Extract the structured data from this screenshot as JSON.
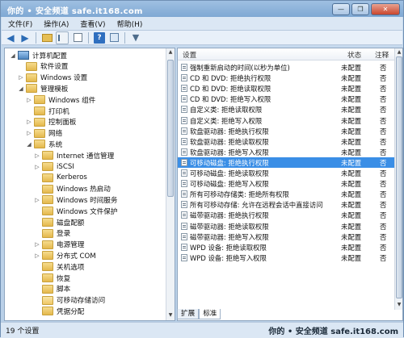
{
  "window": {
    "title": "你的 • 安全频道  safe.it168.com",
    "buttons": [
      "—",
      "❐",
      "✕"
    ]
  },
  "menubar": [
    "文件(F)",
    "操作(A)",
    "查看(V)",
    "帮助(H)"
  ],
  "toolbar": [
    "back-icon",
    "forward-icon",
    "up-folder-icon",
    "show-tree-icon",
    "export-icon",
    "help-icon",
    "view-icon",
    "filter-icon"
  ],
  "tree": [
    {
      "label": "计算机配置",
      "level": 0,
      "arrow": "◢",
      "icon": "computer"
    },
    {
      "label": "软件设置",
      "level": 1,
      "arrow": "",
      "icon": "folder"
    },
    {
      "label": "Windows 设置",
      "level": 1,
      "arrow": "▷",
      "icon": "folder"
    },
    {
      "label": "管理模板",
      "level": 1,
      "arrow": "◢",
      "icon": "folder"
    },
    {
      "label": "Windows 组件",
      "level": 2,
      "arrow": "▷",
      "icon": "folder"
    },
    {
      "label": "打印机",
      "level": 2,
      "arrow": "",
      "icon": "folder"
    },
    {
      "label": "控制面板",
      "level": 2,
      "arrow": "▷",
      "icon": "folder"
    },
    {
      "label": "网络",
      "level": 2,
      "arrow": "▷",
      "icon": "folder"
    },
    {
      "label": "系统",
      "level": 2,
      "arrow": "◢",
      "icon": "folder"
    },
    {
      "label": "Internet 通信管理",
      "level": 3,
      "arrow": "▷",
      "icon": "folder"
    },
    {
      "label": "iSCSI",
      "level": 3,
      "arrow": "▷",
      "icon": "folder"
    },
    {
      "label": "Kerberos",
      "level": 3,
      "arrow": "",
      "icon": "folder"
    },
    {
      "label": "Windows 热启动",
      "level": 3,
      "arrow": "",
      "icon": "folder"
    },
    {
      "label": "Windows 时间服务",
      "level": 3,
      "arrow": "▷",
      "icon": "folder"
    },
    {
      "label": "Windows 文件保护",
      "level": 3,
      "arrow": "",
      "icon": "folder"
    },
    {
      "label": "磁盘配额",
      "level": 3,
      "arrow": "",
      "icon": "folder"
    },
    {
      "label": "登录",
      "level": 3,
      "arrow": "",
      "icon": "folder"
    },
    {
      "label": "电源管理",
      "level": 3,
      "arrow": "▷",
      "icon": "folder"
    },
    {
      "label": "分布式 COM",
      "level": 3,
      "arrow": "▷",
      "icon": "folder"
    },
    {
      "label": "关机选项",
      "level": 3,
      "arrow": "",
      "icon": "folder"
    },
    {
      "label": "恢复",
      "level": 3,
      "arrow": "",
      "icon": "folder"
    },
    {
      "label": "脚本",
      "level": 3,
      "arrow": "",
      "icon": "folder"
    },
    {
      "label": "可移动存储访问",
      "level": 3,
      "arrow": "",
      "icon": "folder-open"
    },
    {
      "label": "凭据分配",
      "level": 3,
      "arrow": "",
      "icon": "folder"
    }
  ],
  "list": {
    "headers": {
      "name": "设置",
      "state": "状态",
      "note": "注释"
    },
    "rows": [
      {
        "name": "强制重新启动的时间(以秒为单位)",
        "state": "未配置",
        "note": "否"
      },
      {
        "name": "CD 和 DVD: 拒绝执行权限",
        "state": "未配置",
        "note": "否"
      },
      {
        "name": "CD 和 DVD: 拒绝读取权限",
        "state": "未配置",
        "note": "否"
      },
      {
        "name": "CD 和 DVD: 拒绝写入权限",
        "state": "未配置",
        "note": "否"
      },
      {
        "name": "自定义类: 拒绝读取权限",
        "state": "未配置",
        "note": "否"
      },
      {
        "name": "自定义类: 拒绝写入权限",
        "state": "未配置",
        "note": "否"
      },
      {
        "name": "软盘驱动器: 拒绝执行权限",
        "state": "未配置",
        "note": "否"
      },
      {
        "name": "软盘驱动器: 拒绝读取权限",
        "state": "未配置",
        "note": "否"
      },
      {
        "name": "软盘驱动器: 拒绝写入权限",
        "state": "未配置",
        "note": "否"
      },
      {
        "name": "可移动磁盘: 拒绝执行权限",
        "state": "未配置",
        "note": "否",
        "selected": true
      },
      {
        "name": "可移动磁盘: 拒绝读取权限",
        "state": "未配置",
        "note": "否"
      },
      {
        "name": "可移动磁盘: 拒绝写入权限",
        "state": "未配置",
        "note": "否"
      },
      {
        "name": "所有可移动存储类: 拒绝所有权限",
        "state": "未配置",
        "note": "否"
      },
      {
        "name": "所有可移动存储: 允许在远程会话中直接访问",
        "state": "未配置",
        "note": "否"
      },
      {
        "name": "磁带驱动器: 拒绝执行权限",
        "state": "未配置",
        "note": "否"
      },
      {
        "name": "磁带驱动器: 拒绝读取权限",
        "state": "未配置",
        "note": "否"
      },
      {
        "name": "磁带驱动器: 拒绝写入权限",
        "state": "未配置",
        "note": "否"
      },
      {
        "name": "WPD 设备: 拒绝读取权限",
        "state": "未配置",
        "note": "否"
      },
      {
        "name": "WPD 设备: 拒绝写入权限",
        "state": "未配置",
        "note": "否"
      }
    ]
  },
  "tabs": [
    "扩展",
    "标准"
  ],
  "status": {
    "count": "19 个设置",
    "watermark": "你的 • 安全频道  safe.it168.com"
  }
}
